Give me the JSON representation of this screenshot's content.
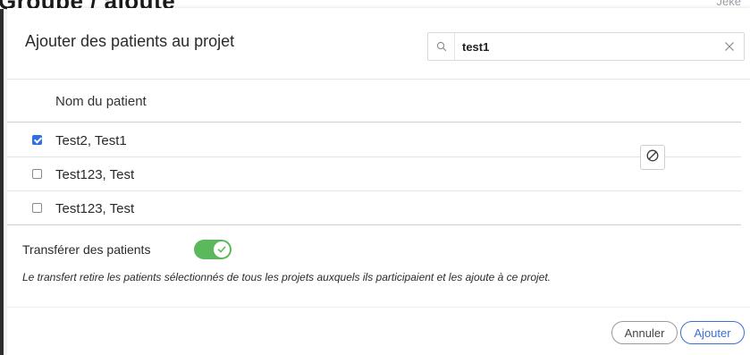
{
  "backdrop": {
    "heading_fragment": "Groupe / ajouté",
    "corner_fragment": "Jeke"
  },
  "modal": {
    "title": "Ajouter des patients au projet",
    "search": {
      "value": "test1",
      "placeholder": "",
      "icon": "search-icon",
      "clear_icon": "close-icon"
    },
    "table": {
      "column_header": "Nom du patient",
      "rows": [
        {
          "name": "Test2, Test1",
          "checked": true
        },
        {
          "name": "Test123, Test",
          "checked": false
        },
        {
          "name": "Test123, Test",
          "checked": false
        }
      ],
      "action_icon": "block-icon"
    },
    "transfer": {
      "label": "Transférer des patients",
      "enabled": true,
      "description": "Le transfert retire les patients sélectionnés de tous les projets auxquels ils participaient et les ajoute à ce projet."
    },
    "footer": {
      "cancel_label": "Annuler",
      "add_label": "Ajouter"
    }
  },
  "colors": {
    "primary": "#3a6fd8",
    "toggle_on": "#5cb85c",
    "checkbox_checked": "#2f6fe0"
  }
}
